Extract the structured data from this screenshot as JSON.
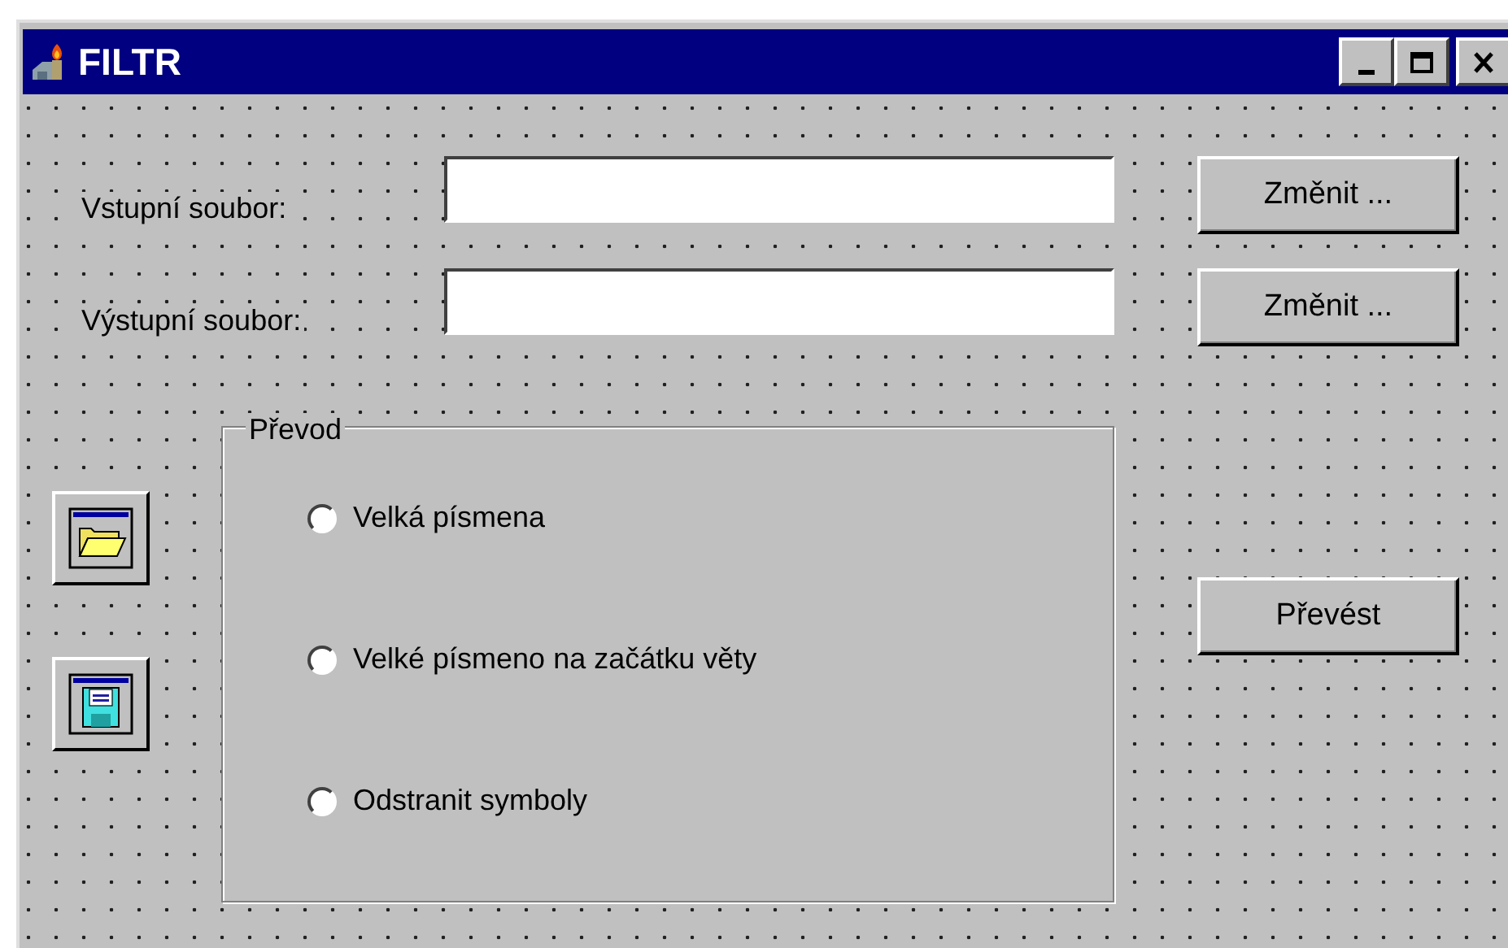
{
  "window": {
    "title": "FILTR"
  },
  "fields": [
    {
      "label": "Vstupní soubor:",
      "button": "Změnit ..."
    },
    {
      "label": "Výstupní soubor:",
      "button": "Změnit ..."
    }
  ],
  "group": {
    "title": "Převod",
    "options": [
      {
        "label": "Velká písmena",
        "selected": false
      },
      {
        "label": "Velké písmeno na začátku věty",
        "selected": false
      },
      {
        "label": "Odstranit symboly",
        "selected": false
      }
    ]
  },
  "convert_button": "Převést"
}
